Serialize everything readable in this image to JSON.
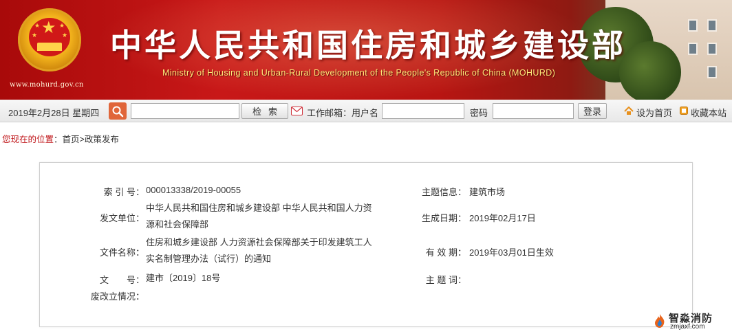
{
  "banner": {
    "title": "中华人民共和国住房和城乡建设部",
    "subtitle": "Ministry of Housing and Urban-Rural Development of the People's Republic of China (MOHURD)",
    "url": "www.mohurd.gov.cn"
  },
  "toolbar": {
    "date": "2019年2月28日 星期四",
    "search_button": "检索",
    "mail_label": "工作邮箱：用户名",
    "password_label": "密码",
    "login_button": "登录",
    "set_home": "设为首页",
    "bookmark": "收藏本站",
    "search_value": "",
    "username_value": "",
    "password_value": ""
  },
  "breadcrumb": {
    "prefix": "您现在的位置",
    "sep": "：",
    "path": "首页>政策发布"
  },
  "doc": {
    "index_label": "索 引 号：",
    "index_value": "000013338/2019-00055",
    "topic_label": "主题信息：",
    "topic_value": "建筑市场",
    "issuer_label": "发文单位：",
    "issuer_line1": "中华人民共和国住房和城乡建设部 中华人民共和国人力资",
    "issuer_line2": "源和社会保障部",
    "date_label": "生成日期：",
    "date_value": "2019年02月17日",
    "name_label": "文件名称：",
    "name_line1": "住房和城乡建设部 人力资源社会保障部关于印发建筑工人",
    "name_line2": "实名制管理办法（试行）的通知",
    "validity_label": "有 效 期：",
    "validity_value": "2019年03月01日生效",
    "docno_label": "文　　号：",
    "docno_value": "建市〔2019〕18号",
    "keywords_label": "主 题 词：",
    "keywords_value": "",
    "status_label": "废改立情况：",
    "status_value": ""
  },
  "watermark": {
    "name": "智淼消防",
    "url": "zmjaxf.com"
  },
  "colors": {
    "banner_red": "#c81818",
    "breadcrumb_red": "#c0171b",
    "search_orange": "#e0663a"
  }
}
